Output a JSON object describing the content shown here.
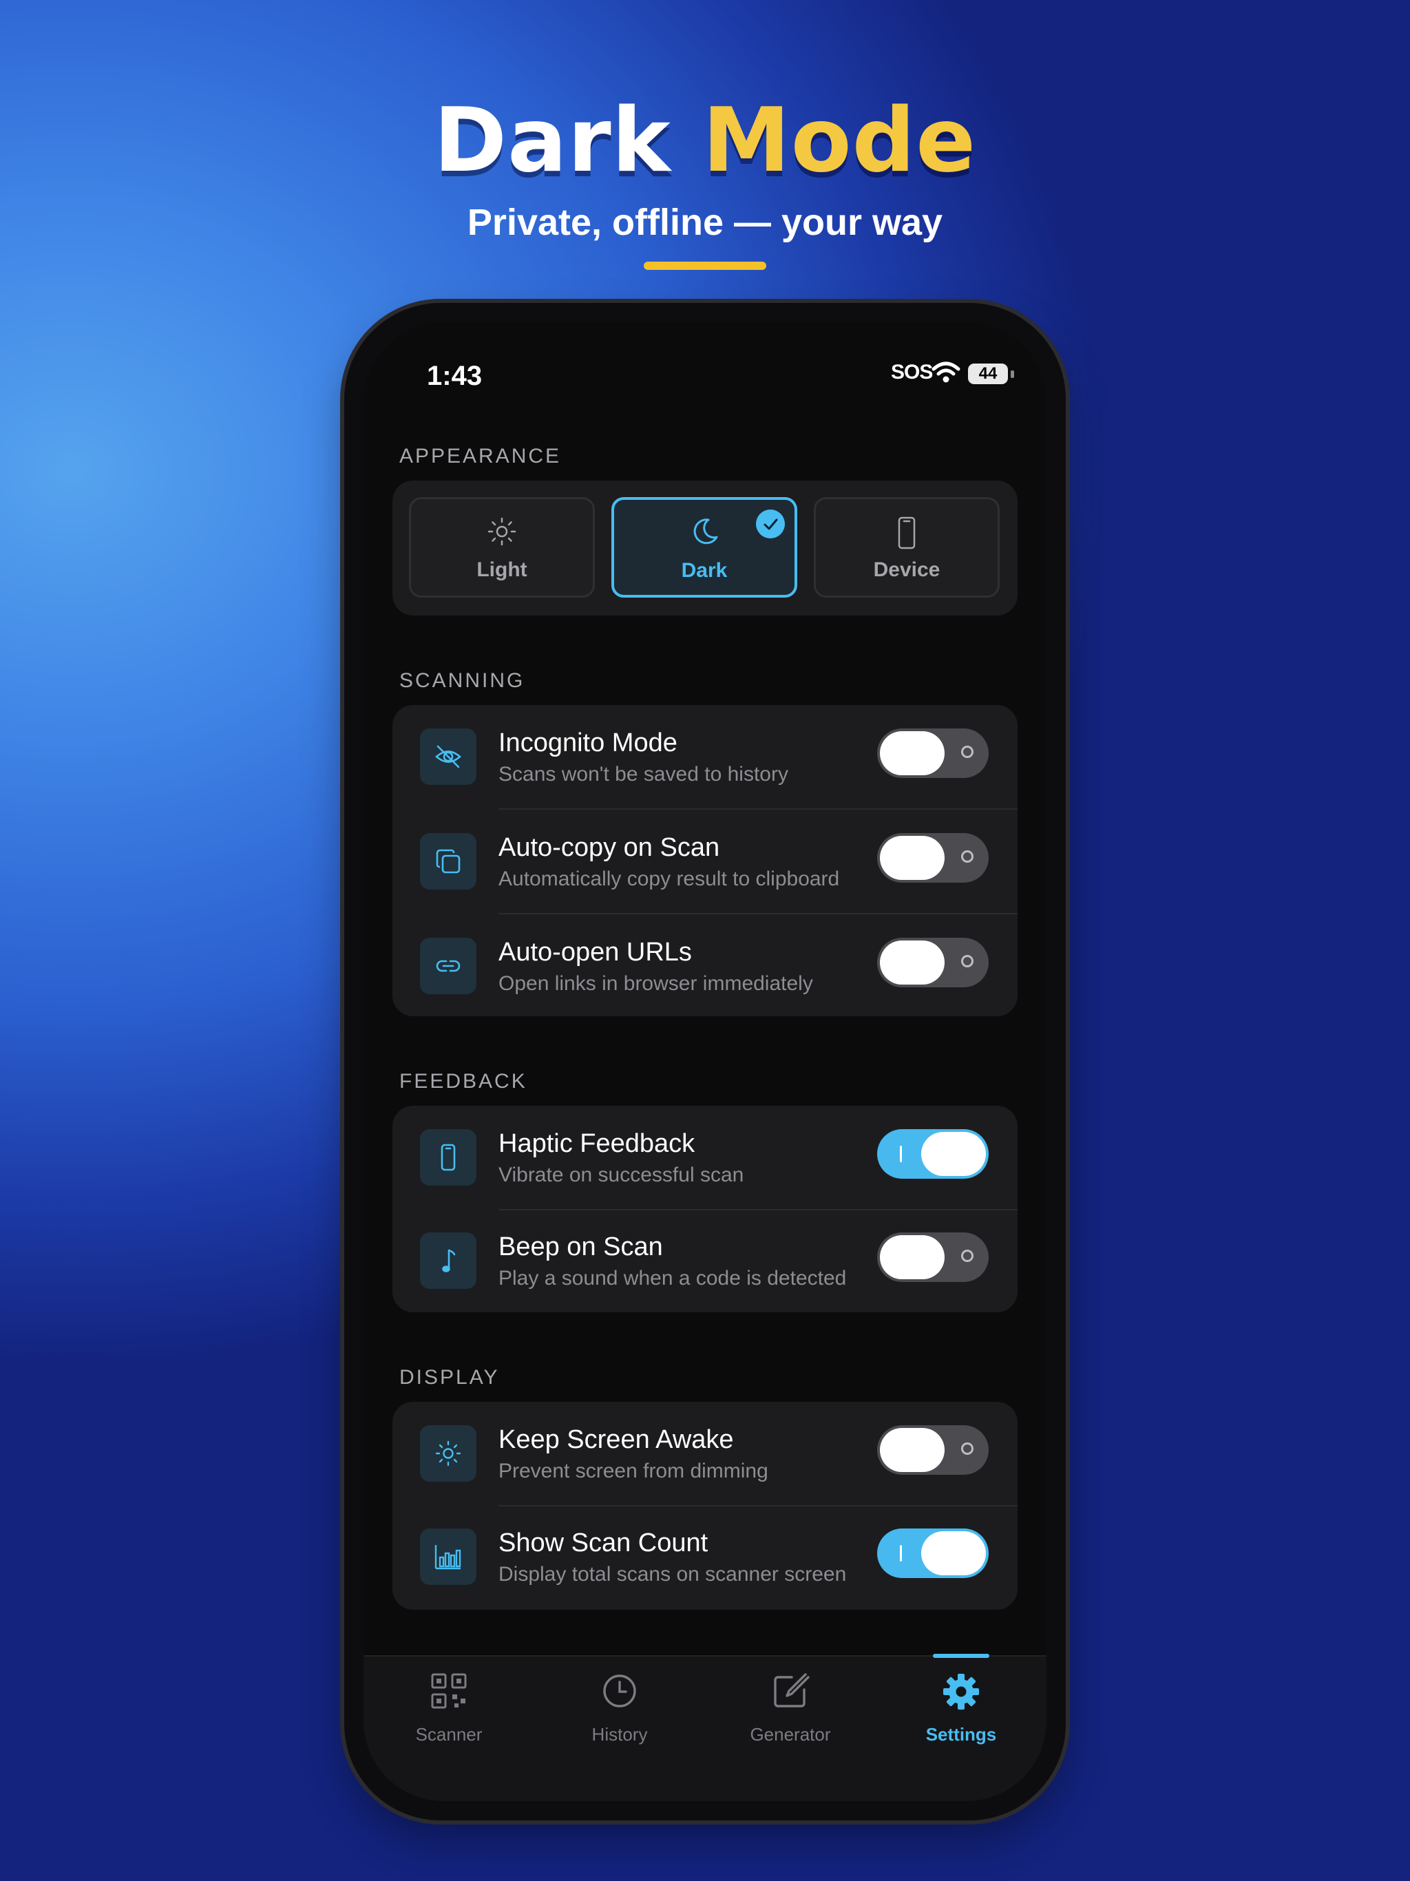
{
  "hero": {
    "title_main": "Dark",
    "title_accent": "Mode",
    "subtitle": "Private, offline — your way"
  },
  "status_bar": {
    "time": "1:43",
    "carrier": "SOS",
    "battery": "44"
  },
  "appearance": {
    "section_label": "APPEARANCE",
    "options": [
      {
        "label": "Light",
        "icon": "sun-icon",
        "selected": false
      },
      {
        "label": "Dark",
        "icon": "moon-icon",
        "selected": true
      },
      {
        "label": "Device",
        "icon": "phone-icon",
        "selected": false
      }
    ]
  },
  "scanning": {
    "section_label": "SCANNING",
    "rows": [
      {
        "title": "Incognito Mode",
        "subtitle": "Scans won't be saved to history",
        "icon": "eye-slash-icon",
        "on": false
      },
      {
        "title": "Auto-copy on Scan",
        "subtitle": "Automatically copy result to clipboard",
        "icon": "copy-icon",
        "on": false
      },
      {
        "title": "Auto-open URLs",
        "subtitle": "Open links in browser immediately",
        "icon": "link-icon",
        "on": false
      }
    ]
  },
  "feedback": {
    "section_label": "FEEDBACK",
    "rows": [
      {
        "title": "Haptic Feedback",
        "subtitle": "Vibrate on successful scan",
        "icon": "phone-icon",
        "on": true
      },
      {
        "title": "Beep on Scan",
        "subtitle": "Play a sound when a code is detected",
        "icon": "music-note-icon",
        "on": false
      }
    ]
  },
  "display": {
    "section_label": "DISPLAY",
    "rows": [
      {
        "title": "Keep Screen Awake",
        "subtitle": "Prevent screen from dimming",
        "icon": "sun-icon",
        "on": false
      },
      {
        "title": "Show Scan Count",
        "subtitle": "Display total scans on scanner screen",
        "icon": "bar-chart-icon",
        "on": true
      }
    ]
  },
  "tabbar": {
    "tabs": [
      {
        "label": "Scanner",
        "icon": "qr-code-icon",
        "active": false
      },
      {
        "label": "History",
        "icon": "clock-icon",
        "active": false
      },
      {
        "label": "Generator",
        "icon": "edit-icon",
        "active": false
      },
      {
        "label": "Settings",
        "icon": "gear-icon",
        "active": true
      }
    ]
  },
  "colors": {
    "accent": "#48bdf2",
    "title_accent": "#f5c842",
    "card_bg": "#1c1c1e",
    "screen_bg": "#0b0b0b"
  }
}
